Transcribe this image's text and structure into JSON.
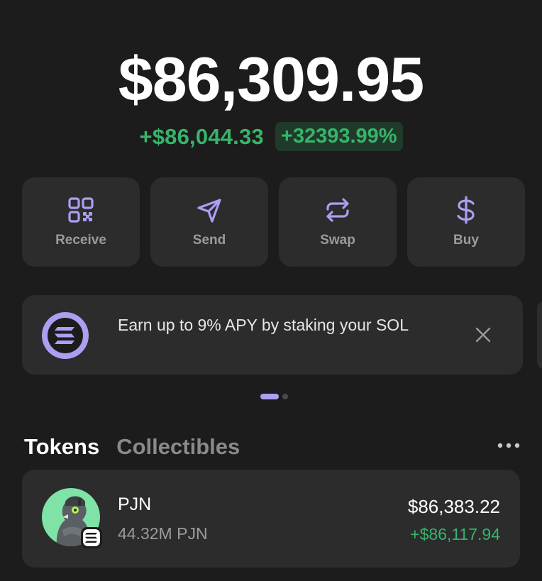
{
  "balance": {
    "total": "$86,309.95",
    "change_amount": "+$86,044.33",
    "change_percent": "+32393.99%"
  },
  "actions": [
    {
      "label": "Receive",
      "icon": "qr-code-icon"
    },
    {
      "label": "Send",
      "icon": "send-icon"
    },
    {
      "label": "Swap",
      "icon": "swap-icon"
    },
    {
      "label": "Buy",
      "icon": "dollar-icon"
    }
  ],
  "banner": {
    "text": "Earn up to 9% APY by staking your SOL",
    "logo_icon": "solana-logo-icon",
    "close_icon": "close-icon"
  },
  "carousel": {
    "pages": 2,
    "active": 1
  },
  "tabs": {
    "tokens": "Tokens",
    "collectibles": "Collectibles"
  },
  "tokens": [
    {
      "name": "PJN",
      "amount": "44.32M PJN",
      "value": "$86,383.22",
      "change": "+$86,117.94"
    }
  ],
  "colors": {
    "background": "#1c1c1c",
    "card": "#2c2c2d",
    "accent": "#ab9ff2",
    "positive": "#37b46a",
    "muted": "#9b9b9f"
  }
}
